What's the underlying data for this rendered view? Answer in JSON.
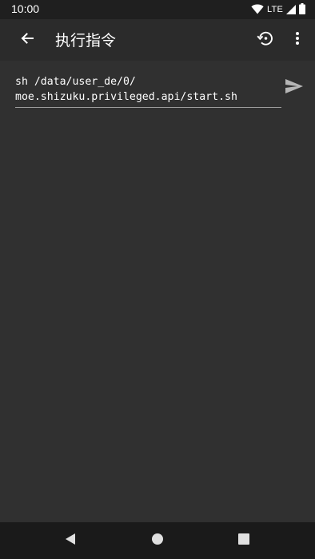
{
  "status_bar": {
    "time": "10:00",
    "network_label": "LTE",
    "icons": [
      "wifi-icon",
      "signal-icon",
      "battery-icon"
    ]
  },
  "app_bar": {
    "title": "执行指令",
    "icons": [
      "arrow-back-icon",
      "history-icon",
      "more-vert-icon"
    ]
  },
  "command": {
    "line1": "sh /data/user_de/0/",
    "line2": "moe.shizuku.privileged.api/start.sh",
    "send_icon": "send-icon"
  },
  "nav_bar": {
    "icons": [
      "nav-back-icon",
      "nav-home-icon",
      "nav-recents-icon"
    ]
  },
  "colors": {
    "status_bar_bg": "#1f1f1f",
    "app_bar_bg": "#2b2b2b",
    "content_bg": "#303030",
    "nav_bar_bg": "#1a1a1a",
    "text_primary": "#ffffff",
    "icon_muted": "#b5b5b5"
  }
}
